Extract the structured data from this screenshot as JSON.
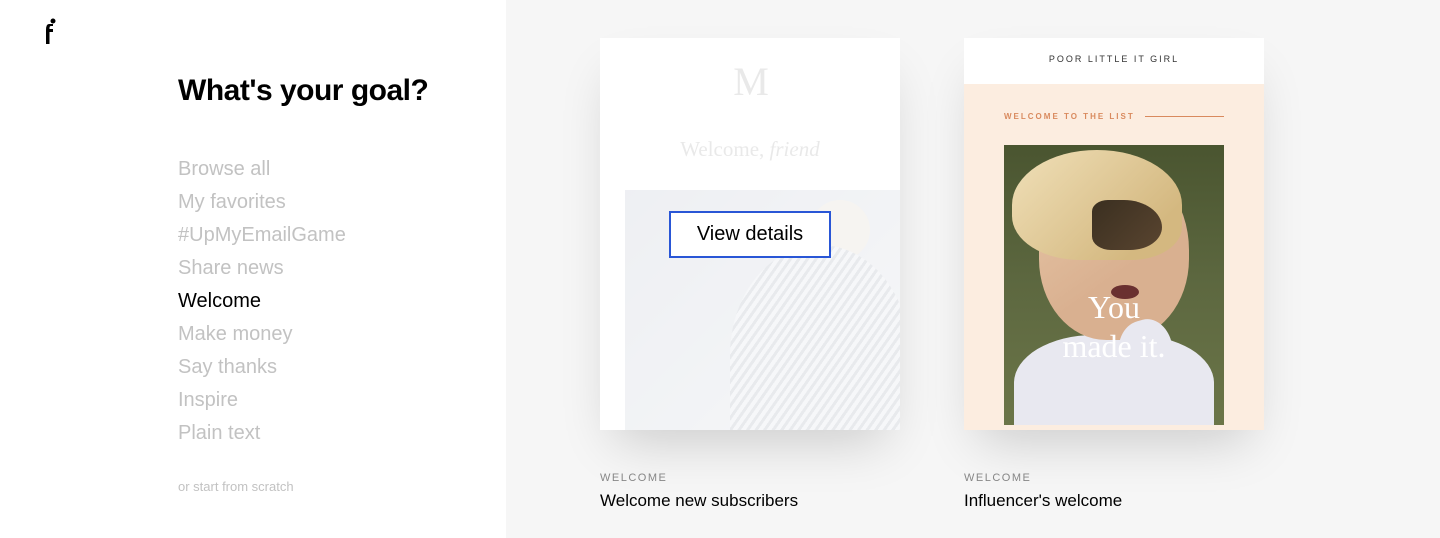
{
  "sidebar": {
    "heading": "What's your goal?",
    "menu": [
      {
        "label": "Browse all",
        "active": false
      },
      {
        "label": "My favorites",
        "active": false
      },
      {
        "label": "#UpMyEmailGame",
        "active": false
      },
      {
        "label": "Share news",
        "active": false
      },
      {
        "label": "Welcome",
        "active": true
      },
      {
        "label": "Make money",
        "active": false
      },
      {
        "label": "Say thanks",
        "active": false
      },
      {
        "label": "Inspire",
        "active": false
      },
      {
        "label": "Plain text",
        "active": false
      }
    ],
    "scratch_link": "or start from scratch"
  },
  "cards": [
    {
      "category": "WELCOME",
      "title": "Welcome new subscribers",
      "view_details_label": "View details",
      "preview": {
        "logo": "M",
        "greeting_prefix": "Welcome, ",
        "greeting_suffix": "friend"
      }
    },
    {
      "category": "WELCOME",
      "title": "Influencer's welcome",
      "preview": {
        "brand": "POOR LITTLE IT GIRL",
        "subtitle": "WELCOME TO THE LIST",
        "overlay_line1": "You",
        "overlay_line2": "made it."
      }
    }
  ]
}
